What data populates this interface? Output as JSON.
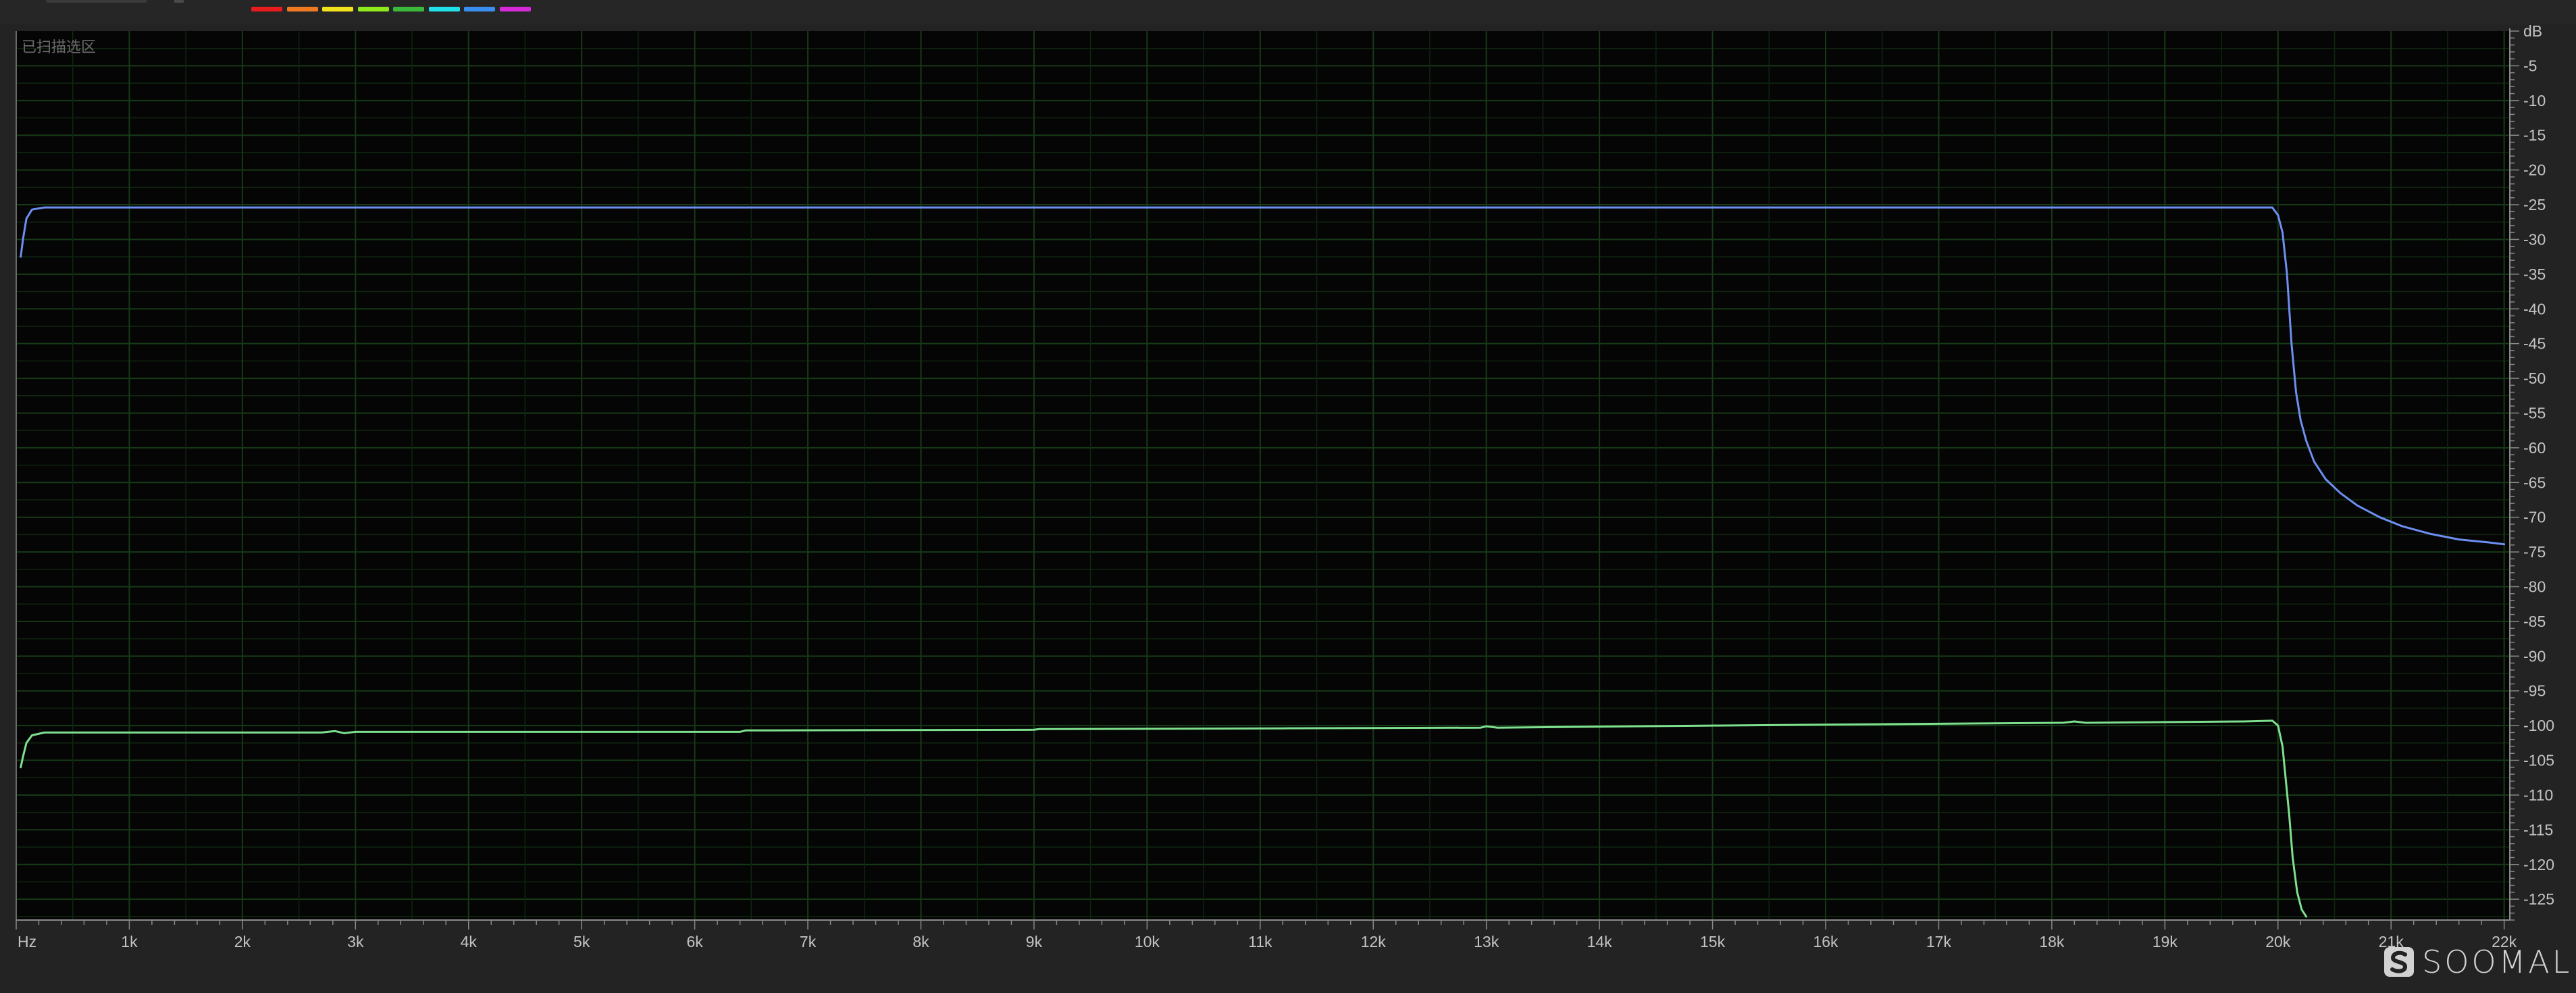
{
  "panel_label": "已扫描选区",
  "series_colors": [
    "#e81c1c",
    "#f07a22",
    "#f2e21c",
    "#8ee81c",
    "#3cb83c",
    "#22e0e8",
    "#3a8ef0",
    "#d62ad8"
  ],
  "watermark": {
    "text": "SOOMAL",
    "icon": "soomal-logo-icon"
  },
  "chart_data": {
    "type": "line",
    "title": "",
    "xlabel": "Hz",
    "ylabel": "dB",
    "xlim": [
      0,
      22050
    ],
    "ylim": [
      -128,
      0
    ],
    "x_ticks": [
      {
        "value": 0,
        "label": "Hz"
      },
      {
        "value": 1000,
        "label": "1k"
      },
      {
        "value": 2000,
        "label": "2k"
      },
      {
        "value": 3000,
        "label": "3k"
      },
      {
        "value": 4000,
        "label": "4k"
      },
      {
        "value": 5000,
        "label": "5k"
      },
      {
        "value": 6000,
        "label": "6k"
      },
      {
        "value": 7000,
        "label": "7k"
      },
      {
        "value": 8000,
        "label": "8k"
      },
      {
        "value": 9000,
        "label": "9k"
      },
      {
        "value": 10000,
        "label": "10k"
      },
      {
        "value": 11000,
        "label": "11k"
      },
      {
        "value": 12000,
        "label": "12k"
      },
      {
        "value": 13000,
        "label": "13k"
      },
      {
        "value": 14000,
        "label": "14k"
      },
      {
        "value": 15000,
        "label": "15k"
      },
      {
        "value": 16000,
        "label": "16k"
      },
      {
        "value": 17000,
        "label": "17k"
      },
      {
        "value": 18000,
        "label": "18k"
      },
      {
        "value": 19000,
        "label": "19k"
      },
      {
        "value": 20000,
        "label": "20k"
      },
      {
        "value": 21000,
        "label": "21k"
      },
      {
        "value": 22000,
        "label": "22k"
      }
    ],
    "y_ticks": [
      {
        "value": 0,
        "label": "dB"
      },
      {
        "value": -5,
        "label": "-5"
      },
      {
        "value": -10,
        "label": "-10"
      },
      {
        "value": -15,
        "label": "-15"
      },
      {
        "value": -20,
        "label": "-20"
      },
      {
        "value": -25,
        "label": "-25"
      },
      {
        "value": -30,
        "label": "-30"
      },
      {
        "value": -35,
        "label": "-35"
      },
      {
        "value": -40,
        "label": "-40"
      },
      {
        "value": -45,
        "label": "-45"
      },
      {
        "value": -50,
        "label": "-50"
      },
      {
        "value": -55,
        "label": "-55"
      },
      {
        "value": -60,
        "label": "-60"
      },
      {
        "value": -65,
        "label": "-65"
      },
      {
        "value": -70,
        "label": "-70"
      },
      {
        "value": -75,
        "label": "-75"
      },
      {
        "value": -80,
        "label": "-80"
      },
      {
        "value": -85,
        "label": "-85"
      },
      {
        "value": -90,
        "label": "-90"
      },
      {
        "value": -95,
        "label": "-95"
      },
      {
        "value": -100,
        "label": "-100"
      },
      {
        "value": -105,
        "label": "-105"
      },
      {
        "value": -110,
        "label": "-110"
      },
      {
        "value": -115,
        "label": "-115"
      },
      {
        "value": -120,
        "label": "-120"
      },
      {
        "value": -125,
        "label": "-125"
      }
    ],
    "grid": true,
    "series": [
      {
        "color": "#6e8ff2",
        "points": [
          [
            40,
            -32.5
          ],
          [
            60,
            -30
          ],
          [
            90,
            -27
          ],
          [
            140,
            -25.7
          ],
          [
            250,
            -25.4
          ],
          [
            2000,
            -25.4
          ],
          [
            6000,
            -25.4
          ],
          [
            10000,
            -25.4
          ],
          [
            14000,
            -25.4
          ],
          [
            18000,
            -25.4
          ],
          [
            19950,
            -25.4
          ],
          [
            20000,
            -26.5
          ],
          [
            20040,
            -29
          ],
          [
            20080,
            -35
          ],
          [
            20120,
            -45
          ],
          [
            20160,
            -52
          ],
          [
            20200,
            -56
          ],
          [
            20250,
            -59
          ],
          [
            20320,
            -62
          ],
          [
            20420,
            -64.5
          ],
          [
            20550,
            -66.5
          ],
          [
            20700,
            -68.3
          ],
          [
            20900,
            -70
          ],
          [
            21100,
            -71.3
          ],
          [
            21350,
            -72.4
          ],
          [
            21600,
            -73.2
          ],
          [
            21850,
            -73.6
          ],
          [
            22000,
            -73.9
          ]
        ]
      },
      {
        "color": "#7ee08e",
        "points": [
          [
            40,
            -106
          ],
          [
            60,
            -104.5
          ],
          [
            90,
            -102.5
          ],
          [
            140,
            -101.4
          ],
          [
            250,
            -101
          ],
          [
            2700,
            -101
          ],
          [
            2820,
            -100.8
          ],
          [
            2900,
            -101.1
          ],
          [
            3000,
            -100.9
          ],
          [
            6400,
            -100.9
          ],
          [
            6450,
            -100.7
          ],
          [
            9000,
            -100.6
          ],
          [
            9050,
            -100.5
          ],
          [
            11200,
            -100.4
          ],
          [
            12950,
            -100.3
          ],
          [
            13000,
            -100.1
          ],
          [
            13100,
            -100.3
          ],
          [
            15000,
            -100
          ],
          [
            16500,
            -99.8
          ],
          [
            18100,
            -99.6
          ],
          [
            18200,
            -99.4
          ],
          [
            18300,
            -99.6
          ],
          [
            19700,
            -99.4
          ],
          [
            19950,
            -99.3
          ],
          [
            20000,
            -100
          ],
          [
            20040,
            -103
          ],
          [
            20070,
            -108
          ],
          [
            20100,
            -113
          ],
          [
            20130,
            -119
          ],
          [
            20170,
            -124
          ],
          [
            20210,
            -126.5
          ],
          [
            20250,
            -127.5
          ]
        ]
      }
    ]
  }
}
